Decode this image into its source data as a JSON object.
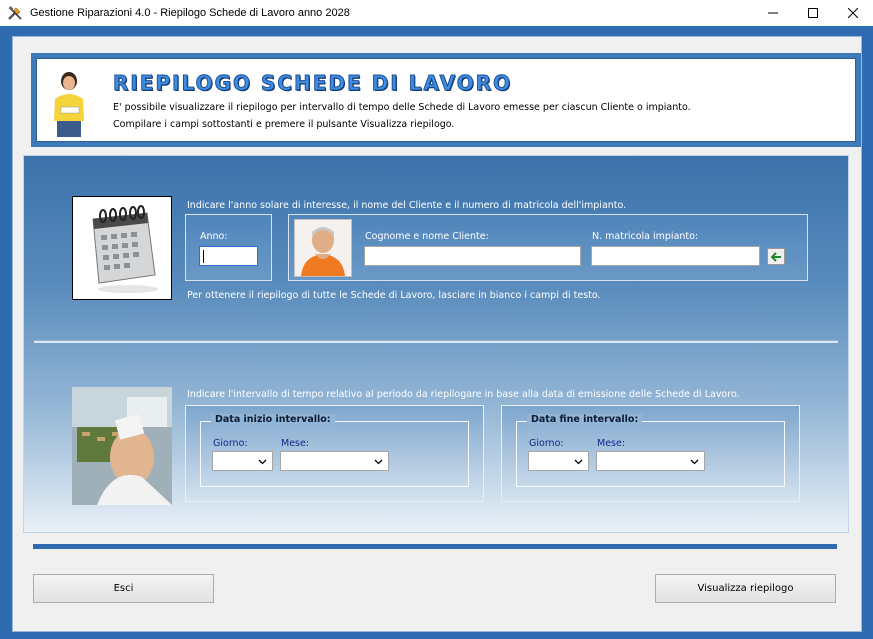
{
  "window": {
    "title": "Gestione Riparazioni 4.0 - Riepilogo Schede di Lavoro anno 2028",
    "app_icon": "tools-icon"
  },
  "header": {
    "title": "RIEPILOGO SCHEDE DI LAVORO",
    "line1": "E' possibile visualizzare il riepilogo per intervallo di tempo delle Schede di Lavoro emesse per ciascun Cliente o impianto.",
    "line2": "Compilare i campi sottostanti e premere il pulsante Visualizza riepilogo."
  },
  "filters": {
    "instructions": "Indicare l'anno solare di interesse, il nome del Cliente e il numero di matricola dell'impianto.",
    "anno_label": "Anno:",
    "anno_value": "",
    "cliente_label": "Cognome e nome Cliente:",
    "cliente_value": "",
    "matricola_label": "N. matricola impianto:",
    "matricola_value": "",
    "note": "Per ottenere il riepilogo di tutte le Schede di Lavoro, lasciare in bianco i campi di testo."
  },
  "interval": {
    "instructions": "Indicare l'intervallo di tempo relativo al periodo da riepilogare in base alla data di emissione delle Schede di Lavoro.",
    "start": {
      "legend": "Data inizio intervallo:",
      "giorno_label": "Giorno:",
      "mese_label": "Mese:",
      "giorno_value": "",
      "mese_value": ""
    },
    "end": {
      "legend": "Data fine intervallo:",
      "giorno_label": "Giorno:",
      "mese_label": "Mese:",
      "giorno_value": "",
      "mese_value": ""
    }
  },
  "buttons": {
    "esci": "Esci",
    "visualizza": "Visualizza riepilogo"
  },
  "colors": {
    "frame_blue": "#2f6bb0",
    "title_blue": "#3f8de0"
  }
}
